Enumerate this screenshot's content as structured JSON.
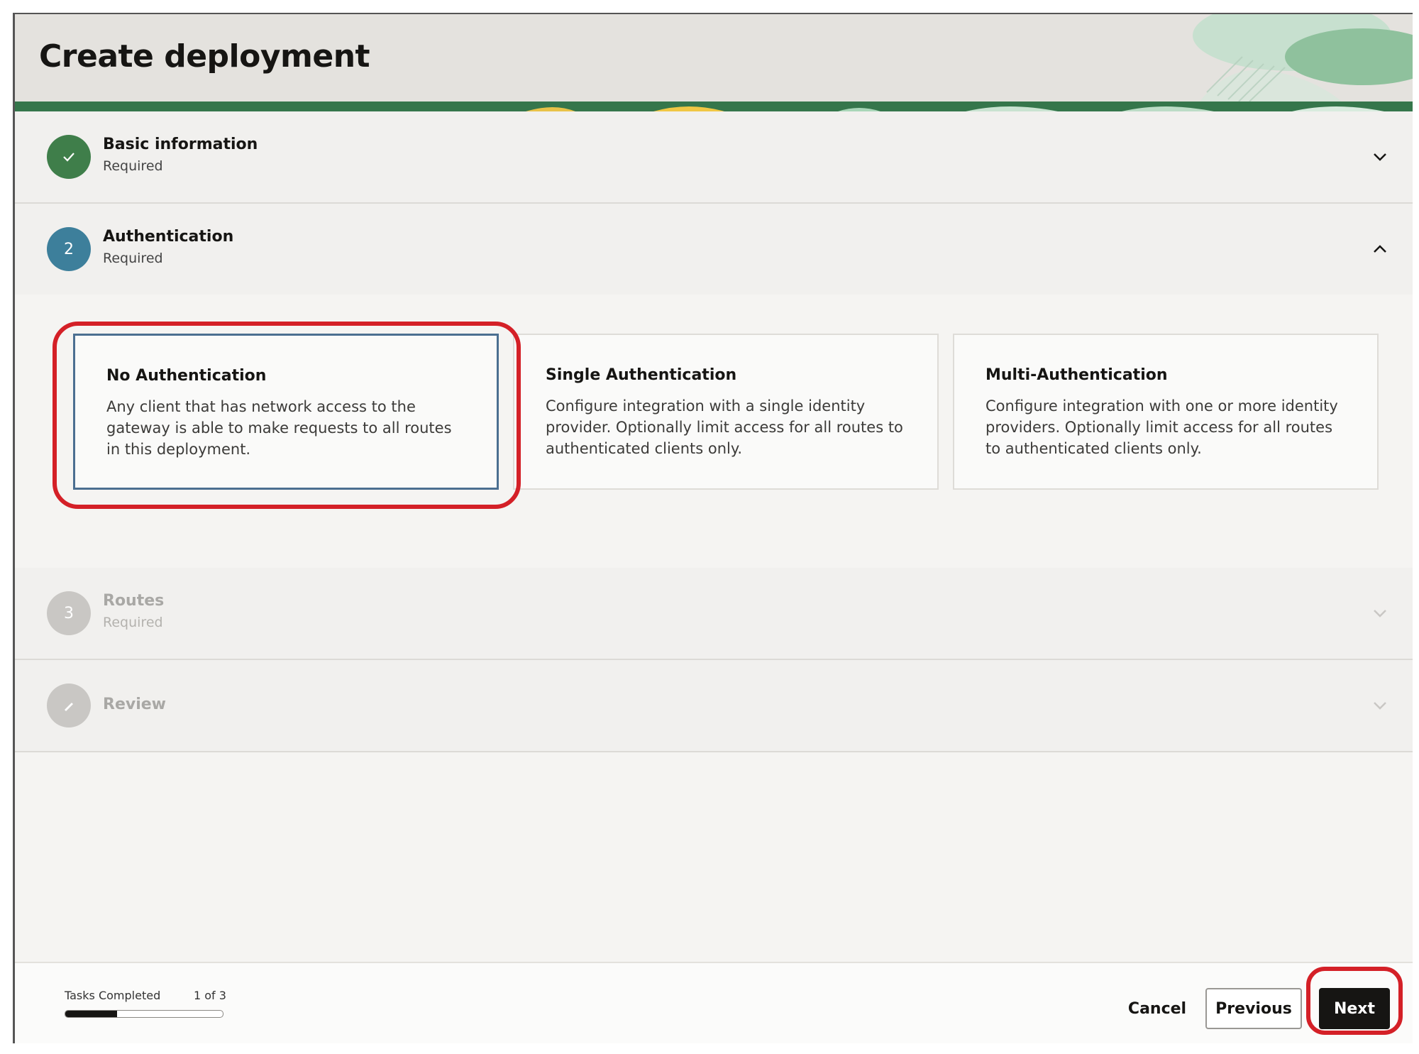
{
  "page": {
    "title": "Create deployment"
  },
  "steps": [
    {
      "label": "Basic information",
      "sub": "Required",
      "marker": "check-icon",
      "state": "completed"
    },
    {
      "label": "Authentication",
      "sub": "Required",
      "marker": "2",
      "state": "active"
    },
    {
      "label": "Routes",
      "sub": "Required",
      "marker": "3",
      "state": "disabled"
    },
    {
      "label": "Review",
      "sub": "",
      "marker": "pencil-icon",
      "state": "disabled"
    }
  ],
  "auth_options": [
    {
      "title": "No Authentication",
      "description": "Any client that has network access to the gateway is able to make requests to all routes in this deployment.",
      "selected": true
    },
    {
      "title": "Single Authentication",
      "description": "Configure integration with a single identity provider. Optionally limit access for all routes to authenticated clients only.",
      "selected": false
    },
    {
      "title": "Multi-Authentication",
      "description": "Configure integration with one or more identity providers. Optionally limit access for all routes to authenticated clients only.",
      "selected": false
    }
  ],
  "footer": {
    "tasks_label": "Tasks Completed",
    "tasks_count": "1 of 3",
    "progress": 0.33,
    "cancel_label": "Cancel",
    "previous_label": "Previous",
    "next_label": "Next"
  },
  "colors": {
    "completed": "#3f7e4a",
    "active": "#3d7f9b",
    "disabled": "#c9c7c4",
    "highlight": "#d42027",
    "selected_border": "#4b6f91"
  }
}
